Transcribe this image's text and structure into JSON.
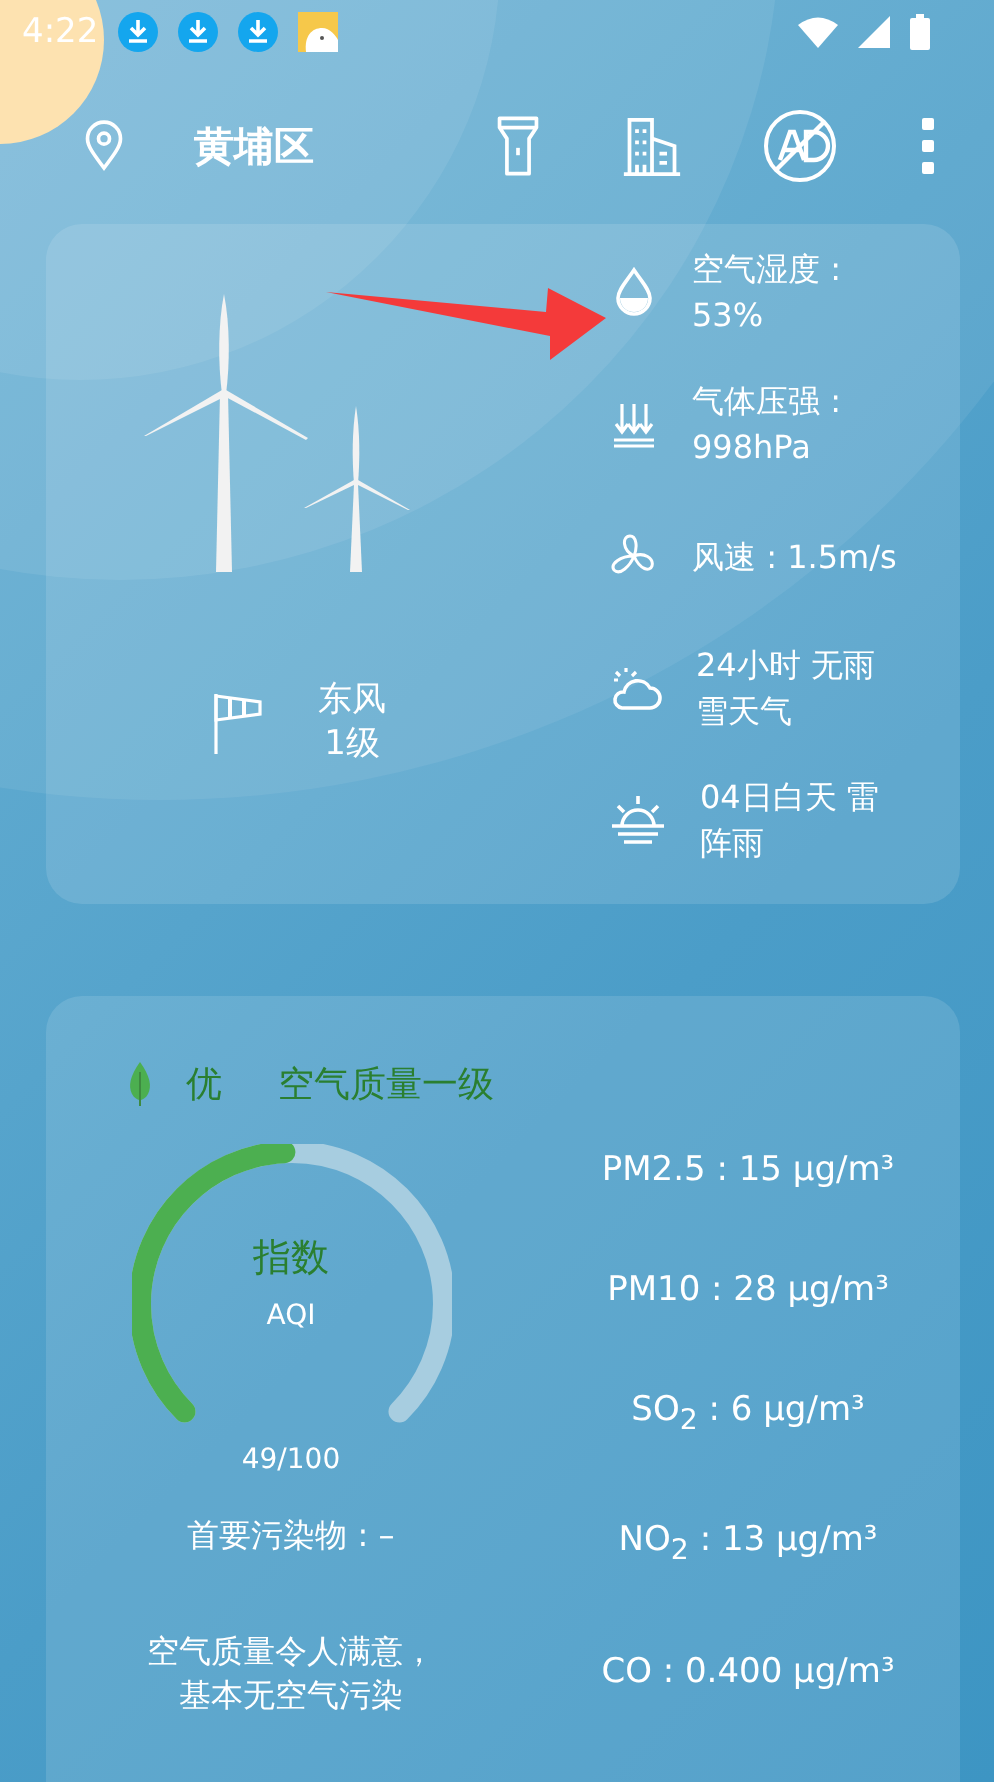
{
  "status_bar": {
    "time": "4:22"
  },
  "toolbar": {
    "location": "黄埔区"
  },
  "weather": {
    "wind_direction": "东风",
    "wind_level": "1级",
    "details": [
      {
        "kind": "humidity",
        "text": "空气湿度 :\n53%"
      },
      {
        "kind": "pressure",
        "text": "气体压强 :\n998hPa"
      },
      {
        "kind": "wind",
        "text": "风速 : 1.5m/s"
      },
      {
        "kind": "cloud",
        "text": "24小时 无雨雪天气"
      },
      {
        "kind": "sunrise",
        "text": "04日白天 雷阵雨"
      }
    ]
  },
  "air_quality": {
    "grade": "优",
    "title": "空气质量一级",
    "gauge_label": "指数",
    "index_name": "AQI",
    "reading": "49/100",
    "primary_pollutant": "首要污染物 : –",
    "description": "空气质量令人满意，基本无空气污染",
    "pollutants": [
      "PM2.5 : 15 μg/m³",
      "PM10 : 28 μg/m³",
      "SO$_{2}$ : 6 μg/m³",
      "NO$_{2}$ : 13 μg/m³",
      "CO : 0.400 μg/m³"
    ]
  }
}
